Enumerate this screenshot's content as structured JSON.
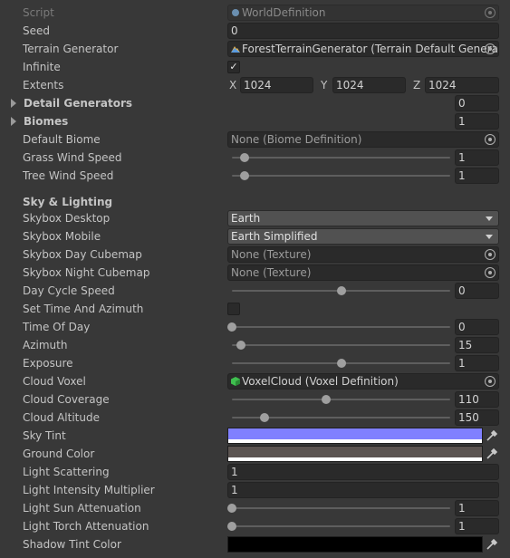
{
  "header": {
    "script_label": "Script",
    "script_value": "WorldDefinition",
    "script_icon": "csharp-script-icon"
  },
  "fields": {
    "seed": {
      "label": "Seed",
      "value": "0"
    },
    "terrain_generator": {
      "label": "Terrain Generator",
      "value": "ForestTerrainGenerator (Terrain Default Generator)",
      "icon": "terrain-icon"
    },
    "infinite": {
      "label": "Infinite",
      "checked": true,
      "check_glyph": "✓"
    },
    "extents": {
      "label": "Extents",
      "x_label": "X",
      "x": "1024",
      "y_label": "Y",
      "y": "1024",
      "z_label": "Z",
      "z": "1024"
    },
    "detail_generators": {
      "label": "Detail Generators",
      "value": "0"
    },
    "biomes": {
      "label": "Biomes",
      "value": "1"
    },
    "default_biome": {
      "label": "Default Biome",
      "value": "None (Biome Definition)"
    },
    "grass_wind_speed": {
      "label": "Grass Wind Speed",
      "value": "1",
      "fraction": 0.06
    },
    "tree_wind_speed": {
      "label": "Tree Wind Speed",
      "value": "1",
      "fraction": 0.06
    }
  },
  "sky": {
    "header": "Sky & Lighting",
    "skybox_desktop": {
      "label": "Skybox Desktop",
      "value": "Earth"
    },
    "skybox_mobile": {
      "label": "Skybox Mobile",
      "value": "Earth Simplified"
    },
    "skybox_day_cubemap": {
      "label": "Skybox Day Cubemap",
      "value": "None (Texture)"
    },
    "skybox_night_cubemap": {
      "label": "Skybox Night Cubemap",
      "value": "None (Texture)"
    },
    "day_cycle_speed": {
      "label": "Day Cycle Speed",
      "value": "0",
      "fraction": 0.5
    },
    "set_time_and_azimuth": {
      "label": "Set Time And Azimuth",
      "checked": false
    },
    "time_of_day": {
      "label": "Time Of Day",
      "value": "0",
      "fraction": 0.0
    },
    "azimuth": {
      "label": "Azimuth",
      "value": "15",
      "fraction": 0.04
    },
    "exposure": {
      "label": "Exposure",
      "value": "1",
      "fraction": 0.5
    },
    "cloud_voxel": {
      "label": "Cloud Voxel",
      "value": "VoxelCloud (Voxel Definition)",
      "icon": "voxel-cube-icon"
    },
    "cloud_coverage": {
      "label": "Cloud Coverage",
      "value": "110",
      "fraction": 0.43
    },
    "cloud_altitude": {
      "label": "Cloud Altitude",
      "value": "150",
      "fraction": 0.15
    },
    "sky_tint": {
      "label": "Sky Tint",
      "color": "#8080ff"
    },
    "ground_color": {
      "label": "Ground Color",
      "color": "#5b5451"
    },
    "light_scattering": {
      "label": "Light Scattering",
      "value": "1"
    },
    "light_intensity_multiplier": {
      "label": "Light Intensity Multiplier",
      "value": "1"
    },
    "light_sun_attenuation": {
      "label": "Light Sun Attenuation",
      "value": "1",
      "fraction": 0.0
    },
    "light_torch_attenuation": {
      "label": "Light Torch Attenuation",
      "value": "1",
      "fraction": 0.0
    },
    "shadow_tint_color": {
      "label": "Shadow Tint Color",
      "color": "#000000"
    }
  },
  "colors": {
    "panel_bg": "#383838",
    "field_bg": "#2a2a2a",
    "dropdown_bg": "#515151"
  }
}
